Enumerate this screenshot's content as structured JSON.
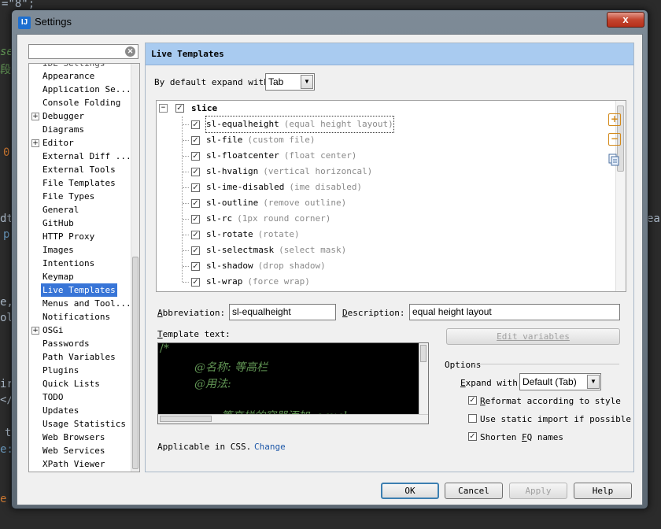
{
  "background": {
    "fragments": [
      {
        "text": "=\"8\";",
        "color": "#a9b7c6"
      },
      {
        "text": "se",
        "color": "#629755"
      },
      {
        "text": "段",
        "color": "#629755"
      },
      {
        "text": "0",
        "color": "#cc7832"
      },
      {
        "text": "dt",
        "color": "#a9b7c6"
      },
      {
        "text": "p",
        "color": "#6897bb"
      },
      {
        "text": "e,",
        "color": "#a9b7c6"
      },
      {
        "text": "ol",
        "color": "#a9b7c6"
      },
      {
        "text": "ea",
        "color": "#a9b7c6"
      },
      {
        "text": "ir",
        "color": "#a9b7c6"
      },
      {
        "text": "</",
        "color": "#a9b7c6"
      },
      {
        "text": "t",
        "color": "#a9b7c6"
      },
      {
        "text": "e:",
        "color": "#6897bb"
      },
      {
        "text": "e",
        "color": "#cc7832"
      }
    ]
  },
  "window": {
    "title": "Settings",
    "icon": "intellij-idea-icon",
    "close": "x"
  },
  "sidebar": {
    "search_value": "",
    "cut_item": "IDE Settings",
    "items": [
      {
        "label": "Appearance",
        "expandable": false
      },
      {
        "label": "Application Se...",
        "expandable": false
      },
      {
        "label": "Console Folding",
        "expandable": false
      },
      {
        "label": "Debugger",
        "expandable": true
      },
      {
        "label": "Diagrams",
        "expandable": false
      },
      {
        "label": "Editor",
        "expandable": true
      },
      {
        "label": "External Diff ...",
        "expandable": false
      },
      {
        "label": "External Tools",
        "expandable": false
      },
      {
        "label": "File Templates",
        "expandable": false
      },
      {
        "label": "File Types",
        "expandable": false
      },
      {
        "label": "General",
        "expandable": false
      },
      {
        "label": "GitHub",
        "expandable": false
      },
      {
        "label": "HTTP Proxy",
        "expandable": false
      },
      {
        "label": "Images",
        "expandable": false
      },
      {
        "label": "Intentions",
        "expandable": false
      },
      {
        "label": "Keymap",
        "expandable": false
      },
      {
        "label": "Live Templates",
        "expandable": false,
        "selected": true
      },
      {
        "label": "Menus and Tool...",
        "expandable": false
      },
      {
        "label": "Notifications",
        "expandable": false
      },
      {
        "label": "OSGi",
        "expandable": true
      },
      {
        "label": "Passwords",
        "expandable": false
      },
      {
        "label": "Path Variables",
        "expandable": false
      },
      {
        "label": "Plugins",
        "expandable": false
      },
      {
        "label": "Quick Lists",
        "expandable": false
      },
      {
        "label": "TODO",
        "expandable": false
      },
      {
        "label": "Updates",
        "expandable": false
      },
      {
        "label": "Usage Statistics",
        "expandable": false
      },
      {
        "label": "Web Browsers",
        "expandable": false
      },
      {
        "label": "Web Services",
        "expandable": false
      },
      {
        "label": "XPath Viewer",
        "expandable": false
      }
    ]
  },
  "panel": {
    "title": "Live Templates",
    "expand_label": "By default expand with",
    "expand_value": "Tab",
    "group": {
      "name": "slice",
      "checked": true
    },
    "templates": [
      {
        "name": "sl-equalheight",
        "desc": "(equal height layout)",
        "checked": true,
        "focused": true
      },
      {
        "name": "sl-file",
        "desc": "(custom file)",
        "checked": true
      },
      {
        "name": "sl-floatcenter",
        "desc": "(float center)",
        "checked": true
      },
      {
        "name": "sl-hvalign",
        "desc": "(vertical horizoncal)",
        "checked": true
      },
      {
        "name": "sl-ime-disabled",
        "desc": "(ime disabled)",
        "checked": true
      },
      {
        "name": "sl-outline",
        "desc": "(remove outline)",
        "checked": true
      },
      {
        "name": "sl-rc",
        "desc": "(1px round corner)",
        "checked": true
      },
      {
        "name": "sl-rotate",
        "desc": "(rotate)",
        "checked": true
      },
      {
        "name": "sl-selectmask",
        "desc": "(select mask)",
        "checked": true
      },
      {
        "name": "sl-shadow",
        "desc": "(drop shadow)",
        "checked": true
      },
      {
        "name": "sl-wrap",
        "desc": "(force wrap)",
        "checked": true
      }
    ],
    "tools": {
      "add": "+",
      "remove": "−",
      "copy": "copy-icon"
    },
    "abbreviation_label_u": "A",
    "abbreviation_label_rest": "bbreviation:",
    "abbreviation_value": "sl-equalheight",
    "description_label_u": "D",
    "description_label_rest": "escription:",
    "description_value": "equal height layout",
    "template_text_label_u": "T",
    "template_text_label_rest": "emplate text:",
    "template_lines": [
      "/*",
      "@名称:   等高栏",
      "@用法:",
      "等高栏的容器添加 .equal..."
    ],
    "edit_variables": "Edit variables",
    "options_title": "Options",
    "expand_with_label_u": "E",
    "expand_with_label_rest": "xpand with",
    "expand_with_value": "Default (Tab)",
    "reformat_u": "R",
    "reformat_rest": "eformat according to style",
    "reformat_checked": true,
    "static_import": "Use static import if possible",
    "static_import_checked": false,
    "shorten_pre": "Shorten ",
    "shorten_u": "F",
    "shorten_rest": "Q names",
    "shorten_checked": true,
    "applicable_text": "Applicable in CSS.",
    "change_link": "Change"
  },
  "buttons": {
    "ok": "OK",
    "cancel": "Cancel",
    "apply": "Apply",
    "help": "Help"
  },
  "colors": {
    "selection": "#3875d7",
    "header": "#a9cbf0",
    "comment_green": "#629755",
    "link": "#1d57a8"
  }
}
